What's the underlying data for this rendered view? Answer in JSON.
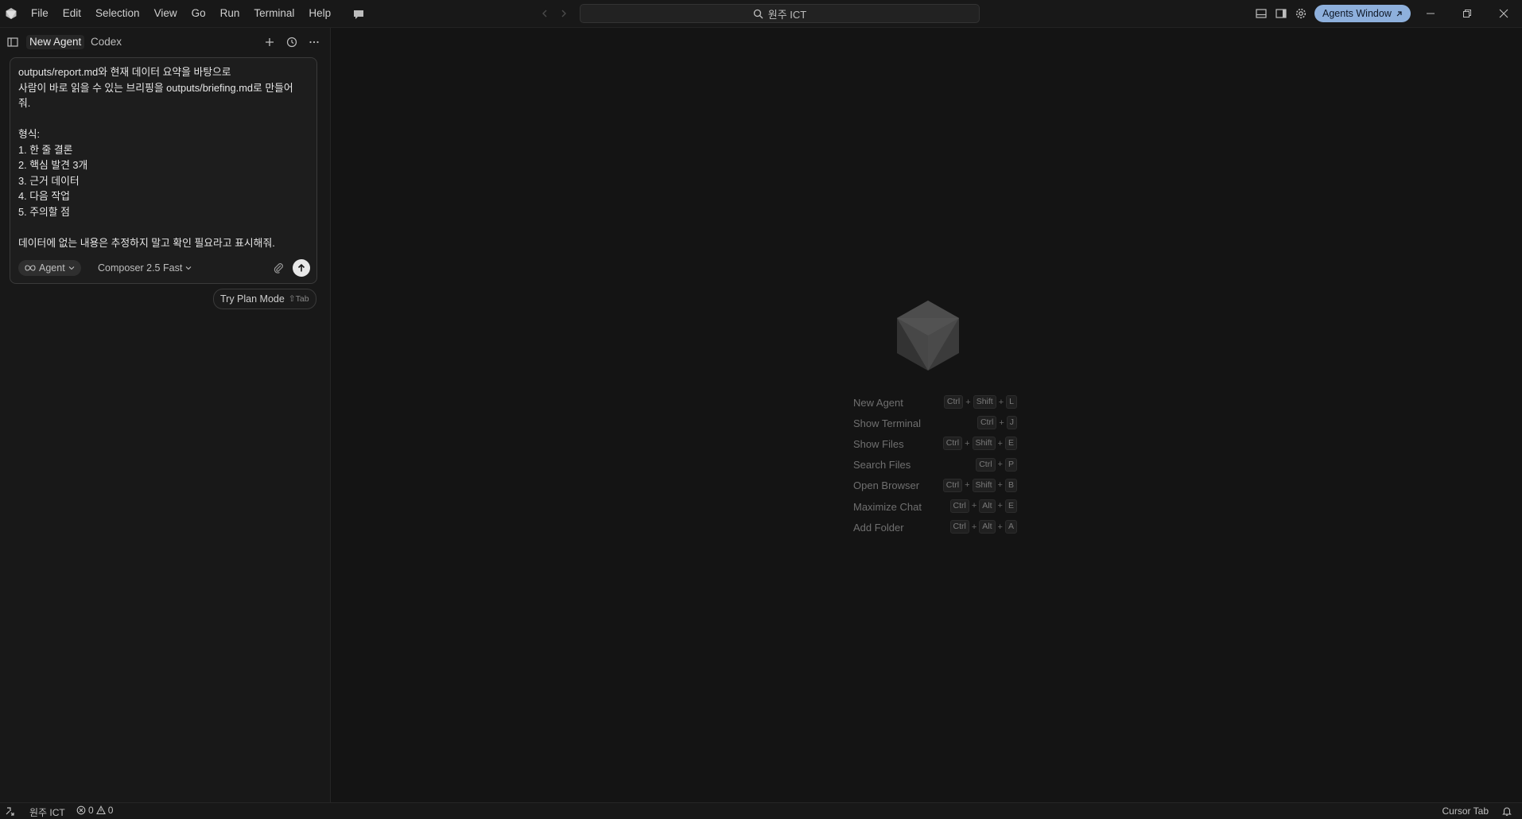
{
  "titlebar": {
    "menu": [
      "File",
      "Edit",
      "Selection",
      "View",
      "Go",
      "Run",
      "Terminal",
      "Help"
    ],
    "search_label": "원주 ICT",
    "agents_window_label": "Agents Window"
  },
  "sidebar": {
    "tabs": [
      "New Agent",
      "Codex"
    ],
    "composer": {
      "text": "outputs/report.md와 현재 데이터 요약을 바탕으로\n사람이 바로 읽을 수 있는 브리핑을 outputs/briefing.md로 만들어\n줘.\n\n형식:\n1. 한 줄 결론\n2. 핵심 발견 3개\n3. 근거 데이터\n4. 다음 작업\n5. 주의할 점\n\n데이터에 없는 내용은 추정하지 말고 확인 필요라고 표시해줘.",
      "mode_label": "Agent",
      "model_label": "Composer 2.5 Fast"
    },
    "plan_mode_hint": "Try Plan Mode",
    "plan_mode_shortcut": "⇧Tab"
  },
  "main": {
    "shortcuts": [
      {
        "label": "New Agent",
        "keys": [
          "Ctrl",
          "Shift",
          "L"
        ]
      },
      {
        "label": "Show Terminal",
        "keys": [
          "Ctrl",
          "J"
        ]
      },
      {
        "label": "Show Files",
        "keys": [
          "Ctrl",
          "Shift",
          "E"
        ]
      },
      {
        "label": "Search Files",
        "keys": [
          "Ctrl",
          "P"
        ]
      },
      {
        "label": "Open Browser",
        "keys": [
          "Ctrl",
          "Shift",
          "B"
        ]
      },
      {
        "label": "Maximize Chat",
        "keys": [
          "Ctrl",
          "Alt",
          "E"
        ]
      },
      {
        "label": "Add Folder",
        "keys": [
          "Ctrl",
          "Alt",
          "A"
        ]
      }
    ]
  },
  "statusbar": {
    "workspace": "원주 ICT",
    "errors": "0",
    "warnings": "0",
    "cursor_tab": "Cursor Tab"
  },
  "colors": {
    "accent": "#8eb0dc",
    "background": "#141414",
    "panel": "#181818"
  }
}
